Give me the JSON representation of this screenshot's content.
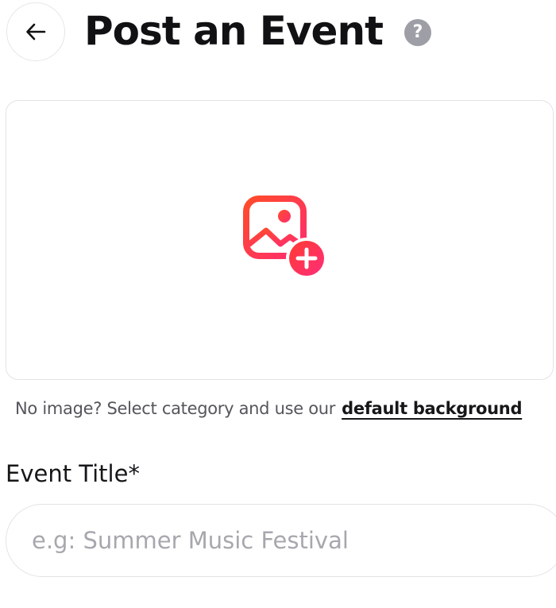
{
  "header": {
    "title": "Post an Event",
    "back_icon": "arrow-left-icon",
    "help_icon": "question-mark-icon",
    "help_glyph": "?"
  },
  "image_upload": {
    "icon": "add-image-icon",
    "gradient_start": "#ff3b3b",
    "gradient_end": "#ff2d7a"
  },
  "hint": {
    "text": "No image? Select category and use our",
    "link_label": "default background"
  },
  "event_title": {
    "label": "Event Title*",
    "value": "",
    "placeholder": "e.g: Summer Music Festival"
  },
  "colors": {
    "accent": "#ff2d55",
    "border": "#e3e3e6",
    "help_badge": "#9d9ea6"
  }
}
